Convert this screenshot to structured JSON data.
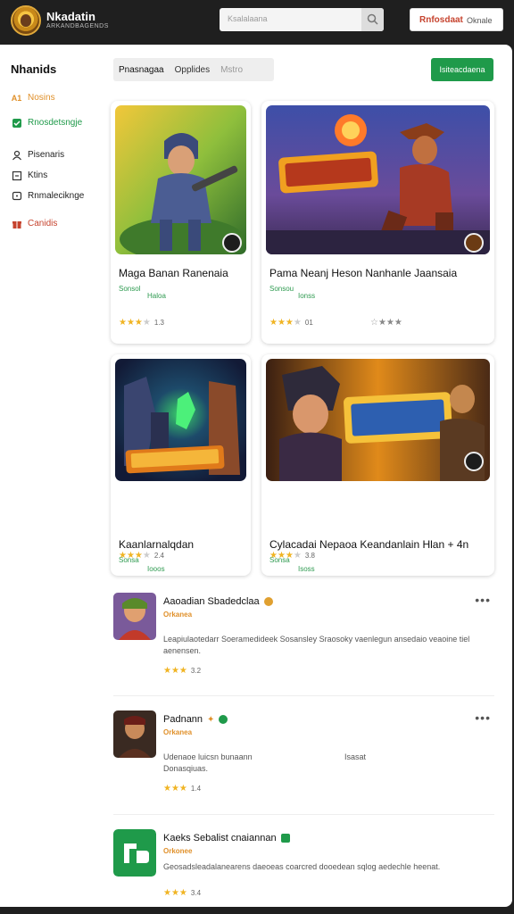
{
  "header": {
    "brand": "Nkadatin",
    "brand_sub": "ARKANDBAGENDS",
    "search_placeholder": "Ksalalaana",
    "account_main": "Rnfosdaat",
    "account_sub": "Oknale"
  },
  "sidebar": {
    "title": "Nhanids",
    "items": [
      {
        "label": "Nosins",
        "icon": "home-icon",
        "color": "#e0902a"
      },
      {
        "label": "Rnosdetsngje",
        "icon": "check-icon",
        "color": "#1f9a4a"
      },
      {
        "label": "Pisenaris",
        "icon": "user-icon",
        "color": "#333333"
      },
      {
        "label": "Ktins",
        "icon": "box-icon",
        "color": "#333333"
      },
      {
        "label": "Rnmaleciknge",
        "icon": "chat-icon",
        "color": "#333333"
      },
      {
        "label": "Canidis",
        "icon": "gift-icon",
        "color": "#c6432e"
      }
    ]
  },
  "toolbar": {
    "tabs": [
      "Pnasnagaa",
      "Opplides",
      "Mstro"
    ],
    "install_label": "Isiteacdaena"
  },
  "cards": [
    {
      "title": "Maga Banan Ranenaia",
      "genre": "Sonsol",
      "sub": "Haloa",
      "rating_value": 3.5,
      "rating_text": "1.3"
    },
    {
      "title": "Pama Neanj Heson Nanhanle Jaansaia",
      "genre": "Sonsou",
      "sub": "Ionss",
      "rating_value": 3,
      "rating_text": "01",
      "extra_stars": 1
    },
    {
      "title": "Kaanlarnalqdan",
      "genre": "Sonsa",
      "sub": "Iooos",
      "rating_value": 3,
      "rating_text": "2.4"
    },
    {
      "title": "Cylacadai Nepaoa Keandanlain Hlan + 4n",
      "genre": "Sonsa",
      "sub": "Isoss",
      "rating_value": 3,
      "rating_text": "3.8"
    }
  ],
  "list": [
    {
      "title": "Aaoadian Sbadedclaa",
      "dev": "Orkanea",
      "desc": "Leapiulaotedarr Soeramedideek Sosansley Sraosoky vaenlegun ansedaio veaoine tiel aenensen.",
      "rating_value": 3,
      "rating_text": "3.2",
      "badge_color": "#e0a030"
    },
    {
      "title": "Padnann",
      "dev": "Orkanea",
      "desc": "Udenaoe luicsn bunaann\nDonasqiuas.",
      "desc_extra": "Isasat",
      "rating_value": 3,
      "rating_text": "1.4",
      "badge_color": "#1f9a4a"
    },
    {
      "title": "Kaeks Sebalist cnaiannan",
      "dev": "Orkonee",
      "desc": "Geosadsleadalanearens daeoeas coarcred dooedean sqlog aedechle heenat.",
      "rating_value": 3,
      "rating_text": "3.4",
      "badge_color": "#1f9a4a"
    }
  ],
  "colors": {
    "accent_green": "#1f9a4a",
    "accent_orange": "#e0902a",
    "star": "#f0b423"
  }
}
